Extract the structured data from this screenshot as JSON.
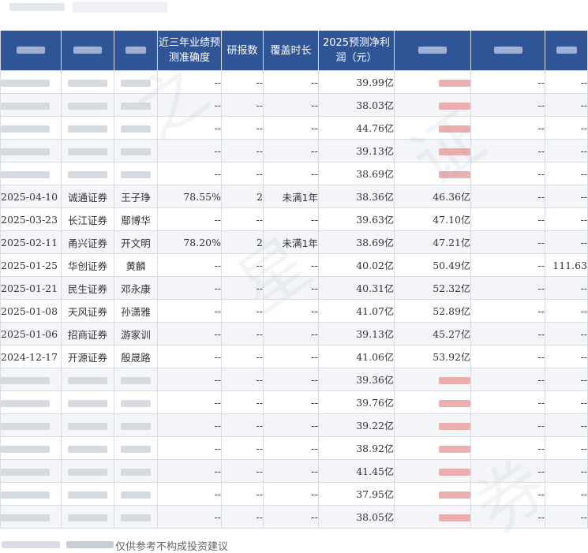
{
  "headers": {
    "accuracy": "近三年业绩预测准确度",
    "reports": "研报数",
    "coverage": "覆盖时长",
    "profit_2025": "2025预测净利润（元）"
  },
  "rows": [
    {
      "date": "",
      "org": "",
      "analyst": "",
      "accuracy": "--",
      "reports": "--",
      "coverage": "--",
      "p2025": "39.99",
      "p2026": "",
      "x1": "--",
      "x2": "--"
    },
    {
      "date": "",
      "org": "",
      "analyst": "",
      "accuracy": "--",
      "reports": "--",
      "coverage": "--",
      "p2025": "38.03",
      "p2026": "",
      "x1": "--",
      "x2": "--"
    },
    {
      "date": "",
      "org": "",
      "analyst": "",
      "accuracy": "--",
      "reports": "--",
      "coverage": "--",
      "p2025": "44.76",
      "p2026": "",
      "x1": "--",
      "x2": "--"
    },
    {
      "date": "",
      "org": "",
      "analyst": "",
      "accuracy": "--",
      "reports": "--",
      "coverage": "--",
      "p2025": "39.13",
      "p2026": "",
      "x1": "--",
      "x2": "--"
    },
    {
      "date": "",
      "org": "",
      "analyst": "",
      "accuracy": "--",
      "reports": "--",
      "coverage": "--",
      "p2025": "38.69",
      "p2026": "",
      "x1": "--",
      "x2": "--"
    },
    {
      "date": "2025-04-10",
      "org": "诚通证券",
      "analyst": "王子琤",
      "accuracy": "78.55%",
      "reports": "2",
      "coverage": "未满1年",
      "p2025": "38.36",
      "p2026": "46.36",
      "x1": "--",
      "x2": "--"
    },
    {
      "date": "2025-03-23",
      "org": "长江证券",
      "analyst": "鄢博华",
      "accuracy": "--",
      "reports": "--",
      "coverage": "--",
      "p2025": "39.63",
      "p2026": "47.10",
      "x1": "--",
      "x2": "--"
    },
    {
      "date": "2025-02-11",
      "org": "甬兴证券",
      "analyst": "开文明",
      "accuracy": "78.20%",
      "reports": "2",
      "coverage": "未满1年",
      "p2025": "38.69",
      "p2026": "47.21",
      "x1": "--",
      "x2": "--"
    },
    {
      "date": "2025-01-25",
      "org": "华创证券",
      "analyst": "黄麟",
      "accuracy": "--",
      "reports": "--",
      "coverage": "--",
      "p2025": "40.02",
      "p2026": "50.49",
      "x1": "--",
      "x2": "111.63"
    },
    {
      "date": "2025-01-21",
      "org": "民生证券",
      "analyst": "邓永康",
      "accuracy": "--",
      "reports": "--",
      "coverage": "--",
      "p2025": "40.31",
      "p2026": "52.32",
      "x1": "--",
      "x2": "--"
    },
    {
      "date": "2025-01-08",
      "org": "天风证券",
      "analyst": "孙潇雅",
      "accuracy": "--",
      "reports": "--",
      "coverage": "--",
      "p2025": "41.07",
      "p2026": "52.89",
      "x1": "--",
      "x2": "--"
    },
    {
      "date": "2025-01-06",
      "org": "招商证券",
      "analyst": "游家训",
      "accuracy": "--",
      "reports": "--",
      "coverage": "--",
      "p2025": "39.13",
      "p2026": "45.27",
      "x1": "--",
      "x2": "--"
    },
    {
      "date": "2024-12-17",
      "org": "开源证券",
      "analyst": "殷晟路",
      "accuracy": "--",
      "reports": "--",
      "coverage": "--",
      "p2025": "41.06",
      "p2026": "53.92",
      "x1": "--",
      "x2": "--"
    },
    {
      "date": "",
      "org": "",
      "analyst": "",
      "accuracy": "--",
      "reports": "--",
      "coverage": "--",
      "p2025": "39.36",
      "p2026": "",
      "x1": "--",
      "x2": "--"
    },
    {
      "date": "",
      "org": "",
      "analyst": "",
      "accuracy": "--",
      "reports": "--",
      "coverage": "--",
      "p2025": "39.76",
      "p2026": "",
      "x1": "--",
      "x2": "--"
    },
    {
      "date": "",
      "org": "",
      "analyst": "",
      "accuracy": "--",
      "reports": "--",
      "coverage": "--",
      "p2025": "39.22",
      "p2026": "",
      "x1": "--",
      "x2": "--"
    },
    {
      "date": "",
      "org": "",
      "analyst": "",
      "accuracy": "--",
      "reports": "--",
      "coverage": "--",
      "p2025": "38.92",
      "p2026": "",
      "x1": "--",
      "x2": "--"
    },
    {
      "date": "",
      "org": "",
      "analyst": "",
      "accuracy": "--",
      "reports": "--",
      "coverage": "--",
      "p2025": "41.45",
      "p2026": "",
      "x1": "--",
      "x2": "--"
    },
    {
      "date": "",
      "org": "",
      "analyst": "",
      "accuracy": "--",
      "reports": "--",
      "coverage": "--",
      "p2025": "37.95",
      "p2026": "",
      "x1": "--",
      "x2": "--"
    },
    {
      "date": "",
      "org": "",
      "analyst": "",
      "accuracy": "--",
      "reports": "--",
      "coverage": "--",
      "p2025": "38.05",
      "p2026": "",
      "x1": "--",
      "x2": "--"
    }
  ],
  "unit_yi": "亿",
  "footer": "仅供参考不构成投资建议",
  "watermark": [
    "之",
    "星",
    "证",
    "券"
  ],
  "colors": {
    "header_bg": "#2f5597",
    "forecast_red": "#c00000",
    "grid": "#d9dde3",
    "alt_row": "#f3f5f8"
  }
}
